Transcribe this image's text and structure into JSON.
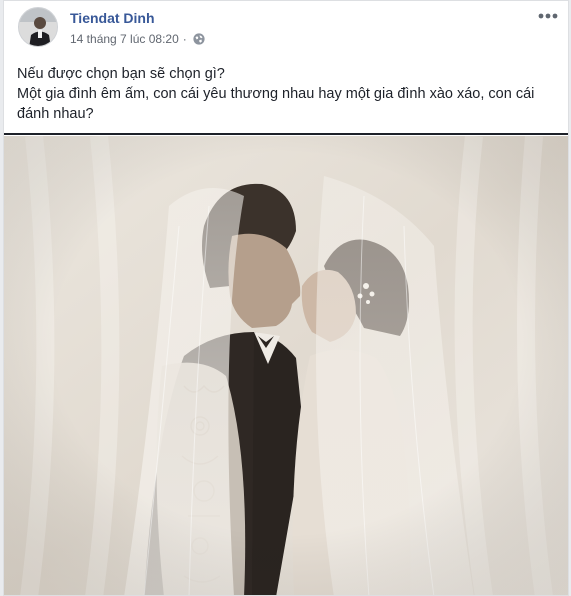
{
  "post": {
    "author_name": "Tiendat Dinh",
    "timestamp": "14 tháng 7 lúc 08:20",
    "separator": "·",
    "privacy_icon": "globe-icon",
    "more_icon": "more-options-icon",
    "text_lines": [
      "Nếu được chọn bạn sẽ chọn gì?",
      "Một gia đình êm ấm, con cái yêu thương nhau hay một gia đình xào xáo, con cái đánh nhau?"
    ],
    "photo_icon": "wedding-photo-icon"
  },
  "colors": {
    "author_link": "#385898",
    "meta_text": "#616770",
    "body_text": "#1d2129",
    "photo_tone": "#e4ded5"
  }
}
